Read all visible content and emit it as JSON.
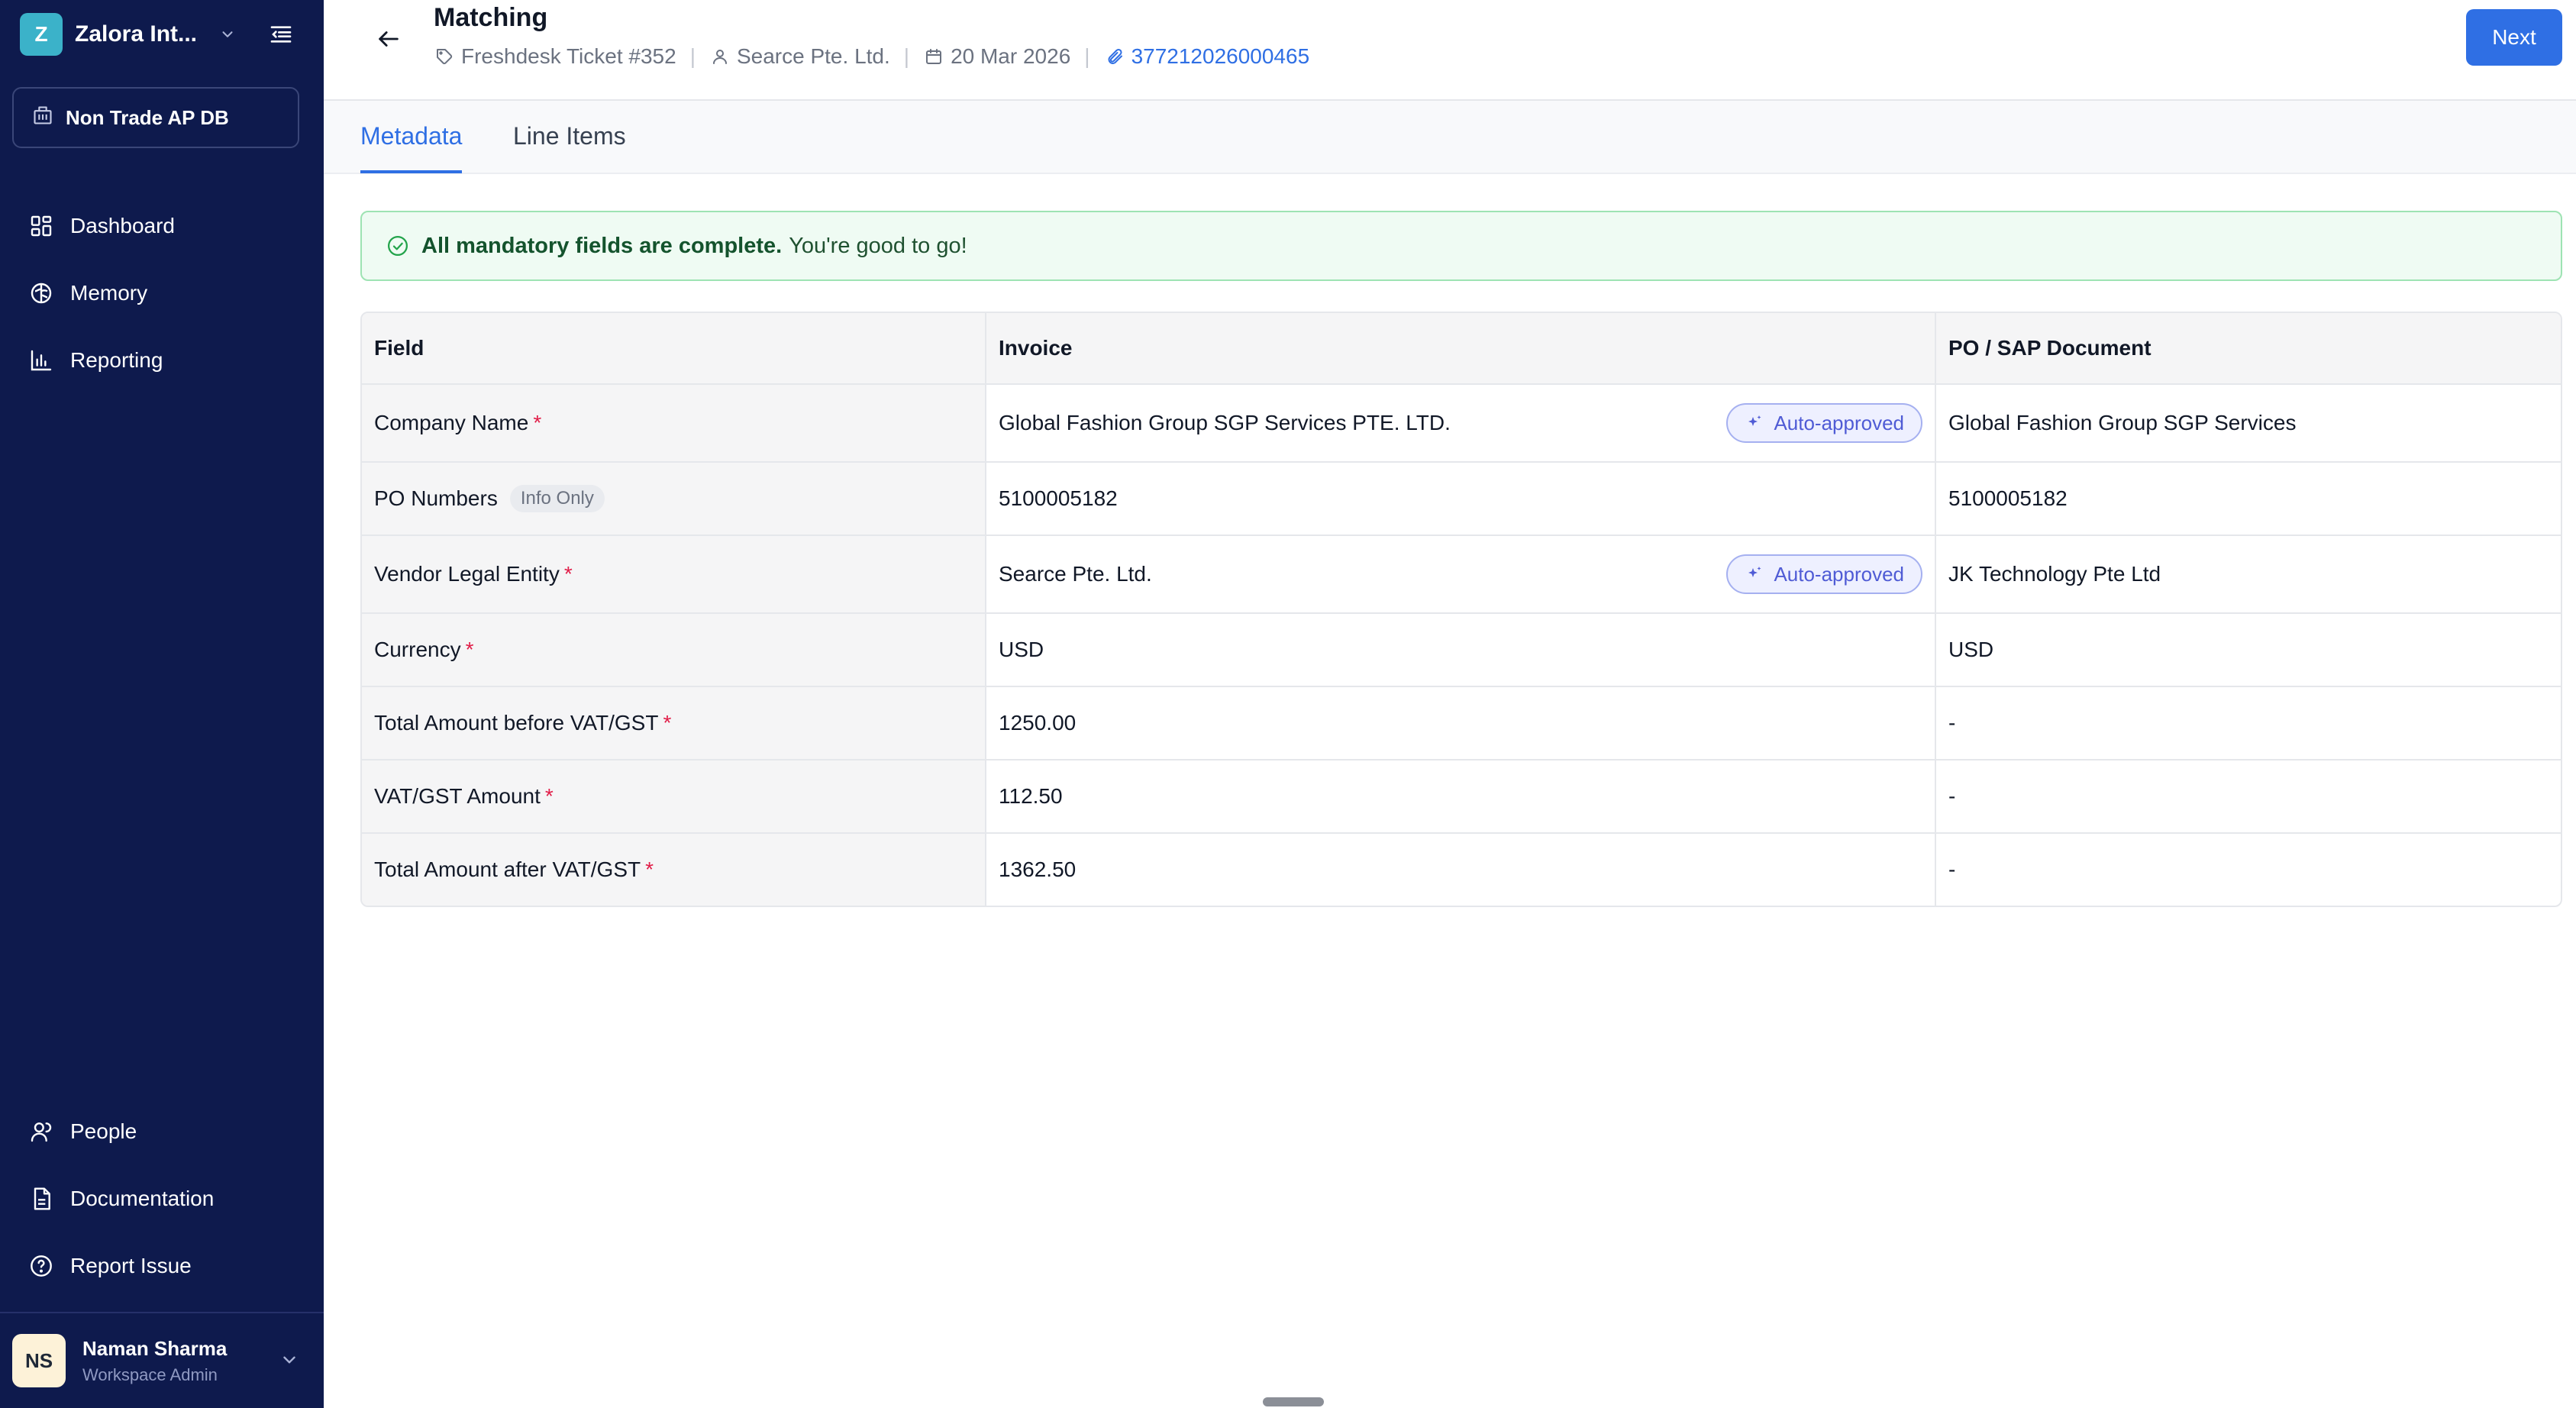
{
  "workspace": {
    "logo_letter": "Z",
    "name": "Zalora Int...",
    "database": "Non Trade AP DB"
  },
  "sidebar": {
    "top_items": [
      {
        "label": "Dashboard",
        "icon": "dashboard-icon"
      },
      {
        "label": "Memory",
        "icon": "brain-icon"
      },
      {
        "label": "Reporting",
        "icon": "bar-chart-icon"
      }
    ],
    "bottom_items": [
      {
        "label": "People",
        "icon": "people-icon"
      },
      {
        "label": "Documentation",
        "icon": "document-icon"
      },
      {
        "label": "Report Issue",
        "icon": "help-circle-icon"
      }
    ]
  },
  "user": {
    "initials": "NS",
    "name": "Naman Sharma",
    "role": "Workspace Admin"
  },
  "header": {
    "title": "Matching",
    "ticket": "Freshdesk Ticket #352",
    "vendor": "Searce Pte. Ltd.",
    "date": "20 Mar 2026",
    "attachment": "377212026000465",
    "separator": "|",
    "next_label": "Next"
  },
  "tabs": [
    {
      "label": "Metadata",
      "active": true
    },
    {
      "label": "Line Items",
      "active": false
    }
  ],
  "banner": {
    "strong": "All mandatory fields are complete.",
    "text": "You're good to go!"
  },
  "table": {
    "headers": [
      "Field",
      "Invoice",
      "PO / SAP Document"
    ],
    "required_mark": "*",
    "rows": [
      {
        "field": "Company Name",
        "required": true,
        "invoice": "Global Fashion Group SGP Services PTE. LTD.",
        "badge": "Auto-approved",
        "po": "Global Fashion Group SGP Services"
      },
      {
        "field": "PO Numbers",
        "tag": "Info Only",
        "invoice": "5100005182",
        "po": "5100005182"
      },
      {
        "field": "Vendor Legal Entity",
        "required": true,
        "invoice": "Searce Pte. Ltd.",
        "badge": "Auto-approved",
        "po": "JK Technology Pte Ltd"
      },
      {
        "field": "Currency",
        "required": true,
        "invoice": "USD",
        "po": "USD"
      },
      {
        "field": "Total Amount before VAT/GST",
        "required": true,
        "invoice": "1250.00",
        "po": "-"
      },
      {
        "field": "VAT/GST Amount",
        "required": true,
        "invoice": "112.50",
        "po": "-"
      },
      {
        "field": "Total Amount after VAT/GST",
        "required": true,
        "invoice": "1362.50",
        "po": "-"
      }
    ]
  },
  "colors": {
    "sidebar_bg": "#0e1a4d",
    "accent": "#2f6fe4",
    "success_bg": "#effbf3",
    "required": "#e11d48"
  }
}
